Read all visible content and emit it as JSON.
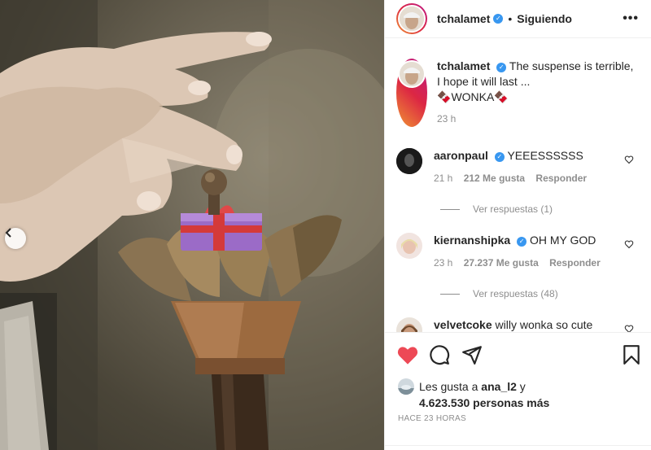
{
  "post": {
    "username": "tchalamet",
    "verified_mark": "✓",
    "separator": "•",
    "follow_status": "Siguiendo",
    "more_label": "•••"
  },
  "caption": {
    "username": "tchalamet",
    "line1": "The suspense is terrible,",
    "line2": "I hope it will last ...",
    "line3_emoji_start": "🍫",
    "line3_text": "WONKA",
    "line3_emoji_end": "🍫",
    "time": "23 h"
  },
  "comments": [
    {
      "username": "aaronpaul",
      "verified": true,
      "text": "YEEESSSSSS",
      "time": "21 h",
      "likes": "212 Me gusta",
      "reply_label": "Responder",
      "replies": "Ver respuestas (1)"
    },
    {
      "username": "kiernanshipka",
      "verified": true,
      "text": "OH MY GOD",
      "time": "23 h",
      "likes": "27.237 Me gusta",
      "reply_label": "Responder",
      "replies": "Ver respuestas (48)"
    },
    {
      "username": "velvetcoke",
      "verified": false,
      "text": "willy wonka so cute"
    }
  ],
  "actions": {
    "like_icon": "heart-icon",
    "comment_icon": "comment-icon",
    "share_icon": "share-icon",
    "save_icon": "bookmark-icon",
    "liked_color": "#ed4956"
  },
  "likes": {
    "prefix": "Les gusta a",
    "user": "ana_l2",
    "and": "y",
    "count": "4.623.530 personas más"
  },
  "posted_ago": "HACE 23 HORAS"
}
